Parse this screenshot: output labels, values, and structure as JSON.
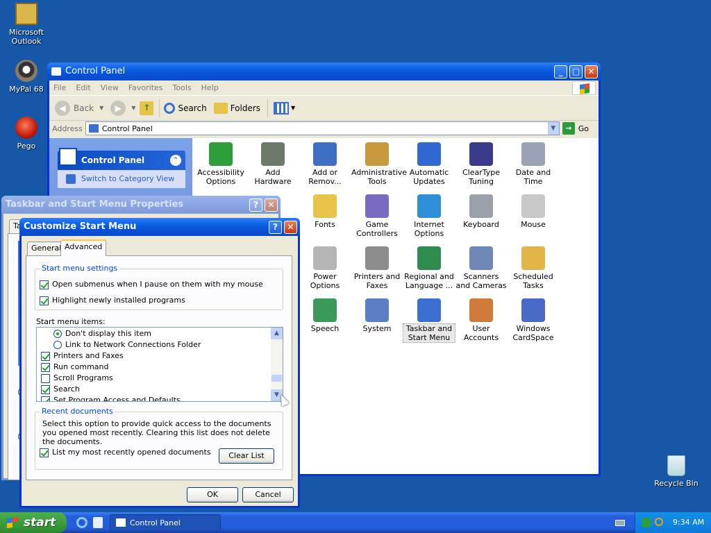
{
  "desktop": {
    "icons": [
      {
        "label": "Microsoft Outlook",
        "icon": "outlook-icon"
      },
      {
        "label": "MyPal 68",
        "icon": "mypal-icon"
      },
      {
        "label": "Pego",
        "icon": "pego-icon"
      },
      {
        "label": "Recycle Bin",
        "icon": "recycle-bin-icon"
      }
    ]
  },
  "control_panel": {
    "title": "Control Panel",
    "menu": [
      "File",
      "Edit",
      "View",
      "Favorites",
      "Tools",
      "Help"
    ],
    "toolbar": {
      "back": "Back",
      "search": "Search",
      "folders": "Folders"
    },
    "address_label": "Address",
    "address_value": "Control Panel",
    "go": "Go",
    "task_pane": {
      "title": "Control Panel",
      "link": "Switch to Category View"
    },
    "items": [
      {
        "label": "Accessibility Options",
        "color": "#2e9e3a"
      },
      {
        "label": "Add Hardware",
        "color": "#6d7a6a"
      },
      {
        "label": "Add or Remov...",
        "color": "#3f6fc4"
      },
      {
        "label": "Administrative Tools",
        "color": "#c99a3b"
      },
      {
        "label": "Automatic Updates",
        "color": "#2f68d1"
      },
      {
        "label": "ClearType Tuning",
        "color": "#3a3a8a"
      },
      {
        "label": "Date and Time",
        "color": "#9aa3b5"
      },
      {
        "label": "Fonts",
        "color": "#e8c34a"
      },
      {
        "label": "Game Controllers",
        "color": "#7a6ac0"
      },
      {
        "label": "Internet Options",
        "color": "#2e8fd6"
      },
      {
        "label": "Keyboard",
        "color": "#9aa0a8"
      },
      {
        "label": "Mouse",
        "color": "#c8c8c8"
      },
      {
        "label": "Power Options",
        "color": "#b5b5b5"
      },
      {
        "label": "Printers and Faxes",
        "color": "#8d8d8d"
      },
      {
        "label": "Regional and Language ...",
        "color": "#2d8c4e"
      },
      {
        "label": "Scanners and Cameras",
        "color": "#6f88b6"
      },
      {
        "label": "Scheduled Tasks",
        "color": "#e2b646"
      },
      {
        "label": "Speech",
        "color": "#3a9a5a"
      },
      {
        "label": "System",
        "color": "#5a7fc2"
      },
      {
        "label": "Taskbar and Start Menu",
        "color": "#3b6fd0"
      },
      {
        "label": "User Accounts",
        "color": "#d07a3a"
      },
      {
        "label": "Windows CardSpace",
        "color": "#4a6ac8"
      }
    ]
  },
  "taskbar_props": {
    "title": "Taskbar and Start Menu Properties",
    "tab_fragment": "Ta"
  },
  "customize": {
    "title": "Customize Start Menu",
    "tabs": [
      "General",
      "Advanced"
    ],
    "settings_legend": "Start menu settings",
    "settings": [
      {
        "label": "Open submenus when I pause on them with my mouse",
        "checked": true
      },
      {
        "label": "Highlight newly installed programs",
        "checked": true
      }
    ],
    "items_label": "Start menu items:",
    "list": [
      {
        "label": "Don't display this item",
        "kind": "radio",
        "checked": true,
        "indent": true
      },
      {
        "label": "Link to Network Connections Folder",
        "kind": "radio",
        "checked": false,
        "indent": true
      },
      {
        "label": "Printers and Faxes",
        "kind": "check",
        "checked": true,
        "indent": false
      },
      {
        "label": "Run command",
        "kind": "check",
        "checked": true,
        "indent": false
      },
      {
        "label": "Scroll Programs",
        "kind": "check",
        "checked": false,
        "indent": false
      },
      {
        "label": "Search",
        "kind": "check",
        "checked": true,
        "indent": false
      },
      {
        "label": "Set Program Access and Defaults",
        "kind": "check",
        "checked": true,
        "indent": false
      }
    ],
    "recent_legend": "Recent documents",
    "recent_desc": "Select this option to provide quick access to the documents you opened most recently.  Clearing this list does not delete the documents.",
    "recent_check": "List my most recently opened documents",
    "clear_list": "Clear List",
    "ok": "OK",
    "cancel": "Cancel"
  },
  "taskbar": {
    "start": "start",
    "task": "Control Panel",
    "clock": "9:34 AM"
  }
}
